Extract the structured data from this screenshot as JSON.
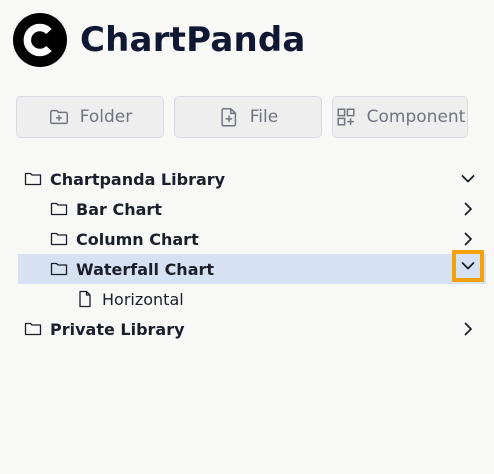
{
  "app": {
    "name": "ChartPanda",
    "colors": {
      "brand_text": "#0f1733",
      "selection_bg": "#d6e2f3",
      "highlight_border": "#f4a10c"
    }
  },
  "toolbar": {
    "folder_label": "Folder",
    "file_label": "File",
    "component_label": "Component"
  },
  "tree": {
    "library": {
      "label": "Chartpanda Library",
      "expanded": true
    },
    "bar_chart": {
      "label": "Bar Chart",
      "expanded": false
    },
    "column_chart": {
      "label": "Column Chart",
      "expanded": false
    },
    "waterfall_chart": {
      "label": "Waterfall Chart",
      "expanded": true,
      "selected": true
    },
    "horizontal": {
      "label": "Horizontal"
    },
    "private_library": {
      "label": "Private Library",
      "expanded": false
    }
  }
}
